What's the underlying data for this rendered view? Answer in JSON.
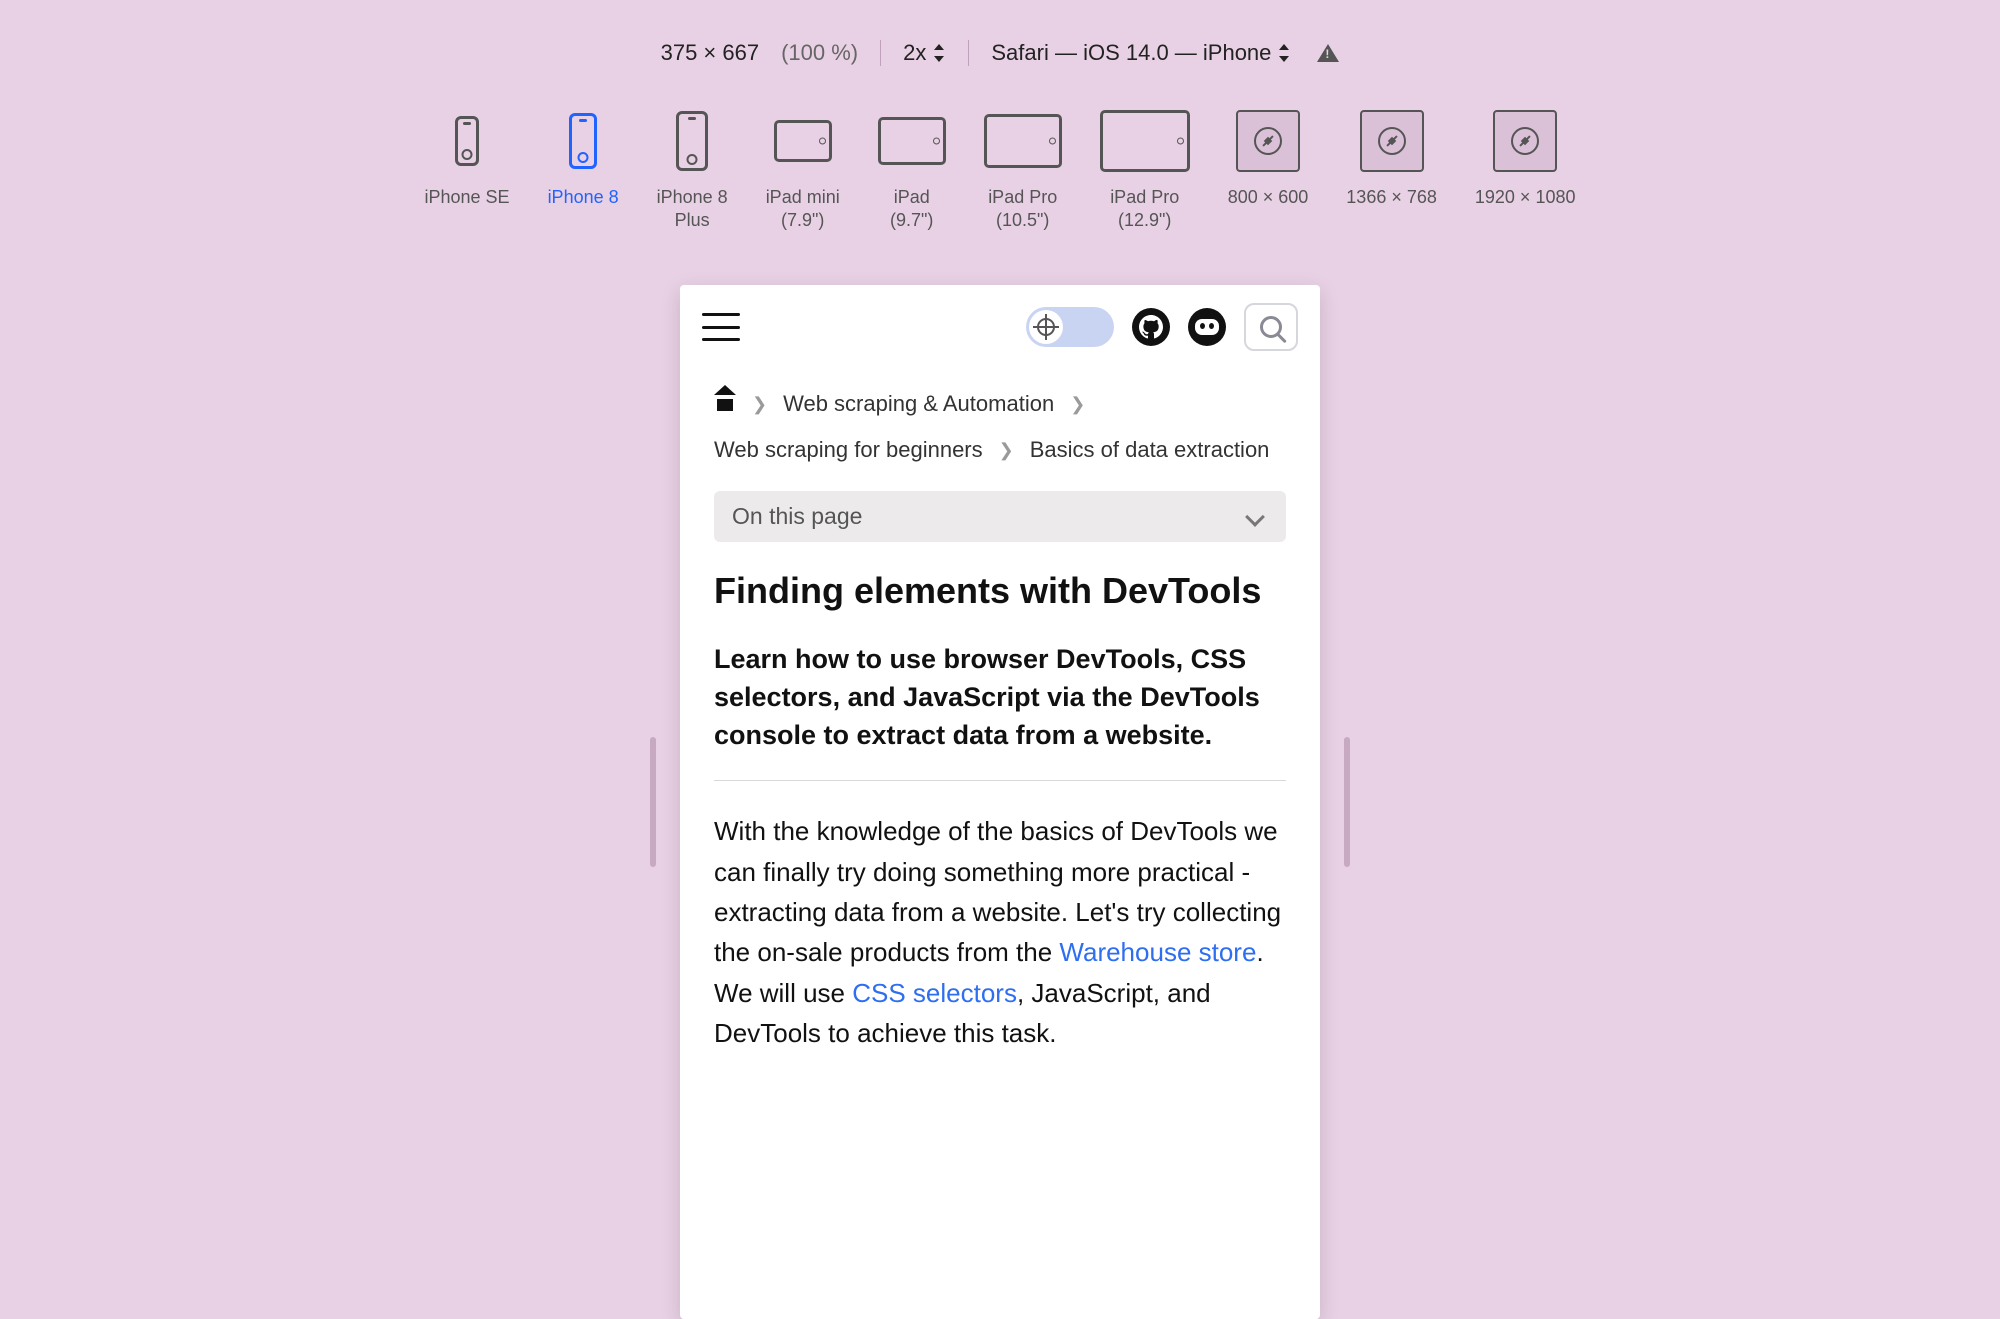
{
  "toolbar": {
    "dimensions": "375 × 667",
    "zoom": "(100 %)",
    "scale": "2x",
    "ua": "Safari — iOS 14.0 — iPhone"
  },
  "devices": [
    {
      "key": "iphone-se",
      "label": "iPhone SE"
    },
    {
      "key": "iphone-8",
      "label": "iPhone 8"
    },
    {
      "key": "iphone-8-plus",
      "label": "iPhone 8\nPlus"
    },
    {
      "key": "ipad-mini",
      "label": "iPad mini\n(7.9\")"
    },
    {
      "key": "ipad",
      "label": "iPad\n(9.7\")"
    },
    {
      "key": "ipad-pro-105",
      "label": "iPad Pro\n(10.5\")"
    },
    {
      "key": "ipad-pro-129",
      "label": "iPad Pro\n(12.9\")"
    },
    {
      "key": "resp-800",
      "label": "800 × 600"
    },
    {
      "key": "resp-1366",
      "label": "1366 × 768"
    },
    {
      "key": "resp-1920",
      "label": "1920 × 1080"
    }
  ],
  "active_device": "iphone-8",
  "page": {
    "breadcrumbs": {
      "b1": "Web scraping & Automation",
      "b2": "Web scraping for beginners",
      "b3": "Basics of data extraction"
    },
    "toc_label": "On this page",
    "title": "Finding elements with DevTools",
    "lead": "Learn how to use browser DevTools, CSS selectors, and JavaScript via the DevTools console to extract data from a website.",
    "para1_a": "With the knowledge of the basics of DevTools we can finally try doing something more practical - extracting data from a website. Let's try collecting the on-sale products from the ",
    "link1": "Warehouse store",
    "para1_b": ". We will use ",
    "link2": "CSS selectors",
    "para1_c": ", JavaScript, and DevTools to achieve this task."
  }
}
